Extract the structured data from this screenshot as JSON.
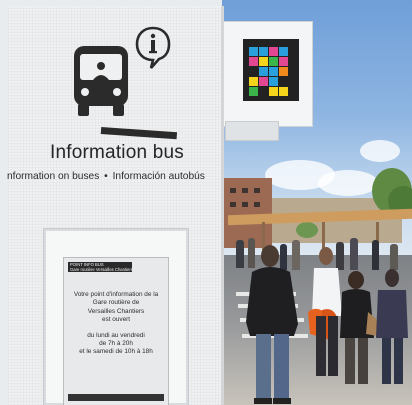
{
  "kiosk": {
    "title": "Information bus",
    "subtitle_fr": "nformation on buses",
    "subtitle_separator": "•",
    "subtitle_es": "Información autobús",
    "icons": [
      "bus-icon",
      "info-bubble-icon"
    ]
  },
  "notice": {
    "header_line1": "POINT INFO BUS",
    "header_line2": "Gare routière Versailles Chantiers",
    "lines": [
      "Votre point d'information de la",
      "Gare routière de",
      "Versailles Chantiers",
      "est ouvert"
    ],
    "hours_lines": [
      "du lundi au vendredi",
      "de 7h à 20h",
      "et le samedi de 10h à 18h"
    ]
  },
  "colors": {
    "kiosk": "#eef0f1",
    "text": "#262626",
    "sky": "#8fb6e2",
    "jacket_orange": "#e8621f",
    "qr_cells": [
      "#29a0dc",
      "#e34792",
      "#f5d51c",
      "#39b54a",
      "#f08a1d"
    ]
  }
}
